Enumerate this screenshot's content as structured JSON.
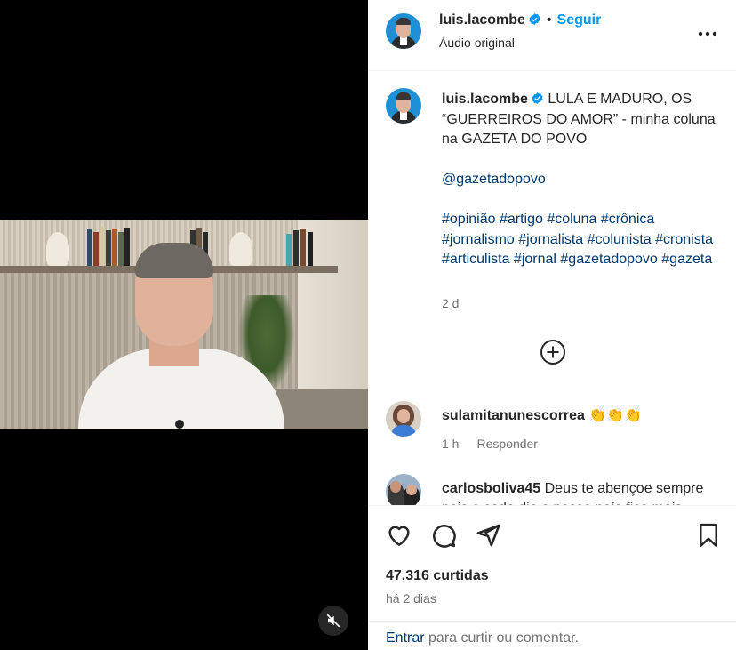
{
  "post": {
    "username": "luis.lacombe",
    "dot": "•",
    "follow_label": "Seguir",
    "audio": "Áudio original",
    "more_icon": "more-horizontal-icon"
  },
  "caption": {
    "username": "luis.lacombe",
    "title": "LULA E MADURO, OS “GUERREIROS DO AMOR” - minha coluna na GAZETA DO POVO",
    "mention": "@gazetadopovo",
    "hashtags": "#opinião #artigo #coluna #crônica #jornalismo #jornalista #colunista #cronista #articulista #jornal #gazetadopovo #gazeta",
    "time": "2 d"
  },
  "comments": [
    {
      "username": "sulamitanunescorrea",
      "text": "👏👏👏",
      "time": "1 h",
      "reply_label": "Responder"
    },
    {
      "username": "carlosboliva45",
      "text": "Deus te abençoe sempre pois a cada dia o nosso país fica mais"
    }
  ],
  "stats": {
    "likes": "47.316 curtidas",
    "posted": "há 2 dias"
  },
  "login": {
    "link": "Entrar",
    "rest": " para curtir ou comentar."
  },
  "colors": {
    "accent": "#0095f6",
    "text": "#262626",
    "secondary": "#737373",
    "link": "#00376b"
  }
}
